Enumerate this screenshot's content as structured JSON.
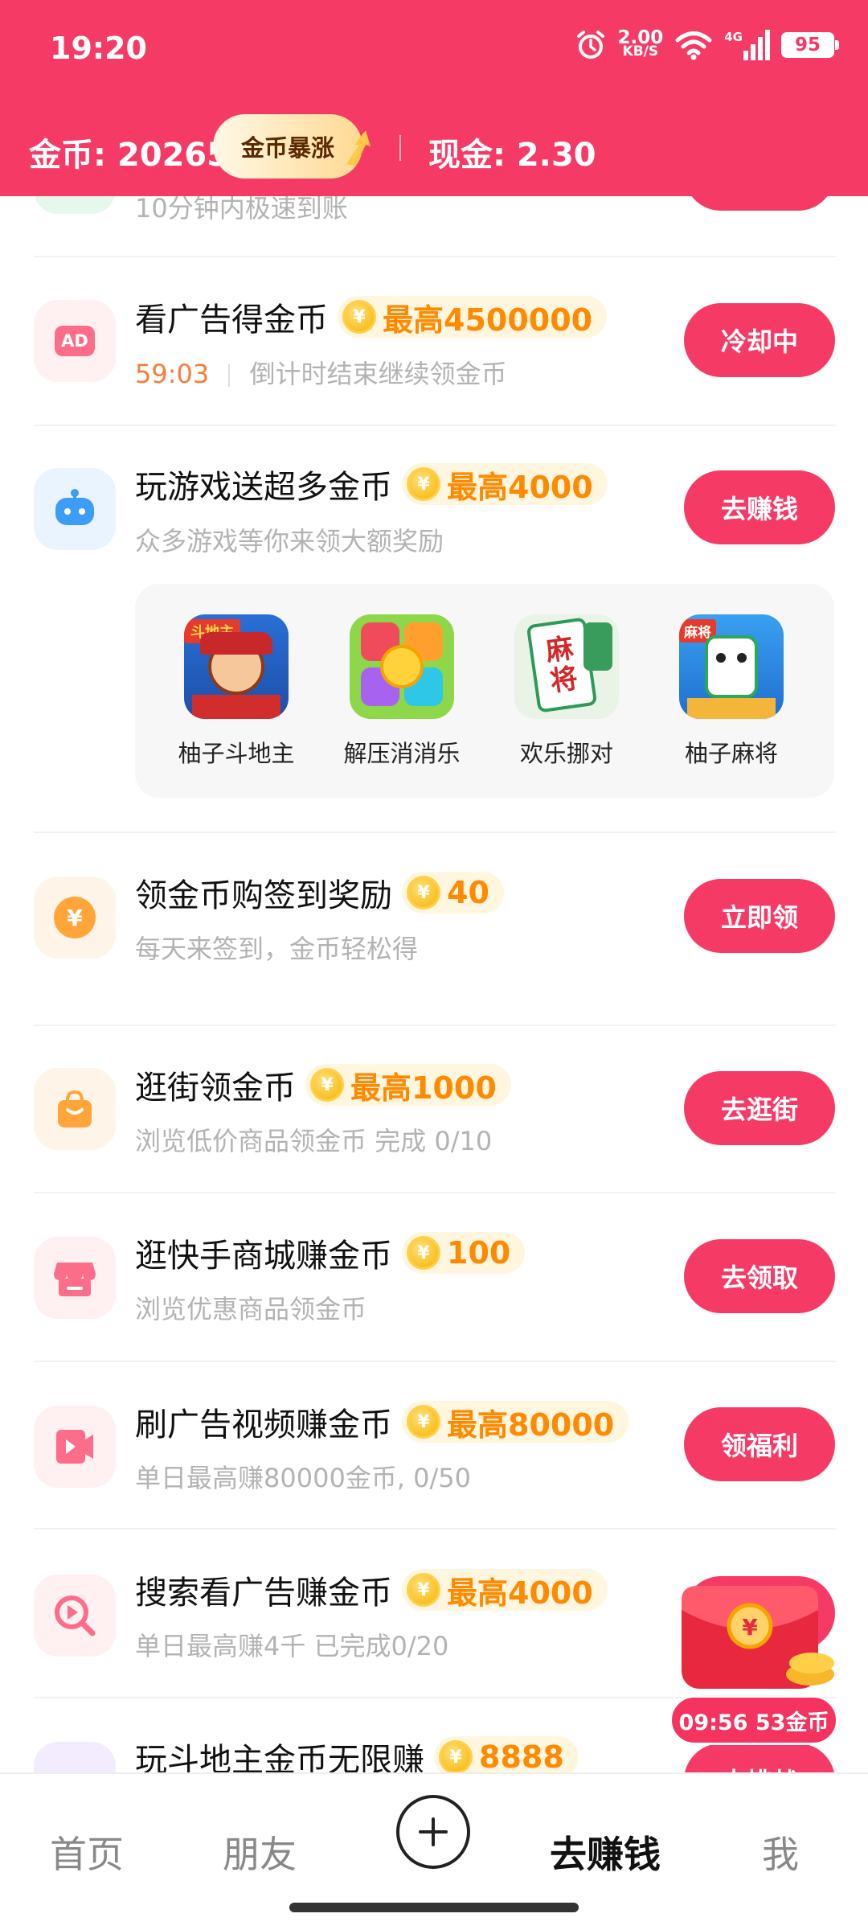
{
  "status_bar": {
    "time": "19:20",
    "net_speed": "2.00",
    "net_unit": "KB/S",
    "network": "4G",
    "battery": "95"
  },
  "header": {
    "coins_label": "金币: 20265",
    "boom_label": "金币暴涨",
    "cash_label": "现金: 2.30"
  },
  "partial_row": {
    "subtitle": "10分钟内极速到账"
  },
  "tasks": [
    {
      "title": "看广告得金币",
      "reward": "最高4500000",
      "countdown": "59:03",
      "subtitle": "倒计时结束继续领金币",
      "button": "冷却中",
      "icon": "ad-icon"
    },
    {
      "title": "玩游戏送超多金币",
      "reward": "最高4000",
      "subtitle": "众多游戏等你来领大额奖励",
      "button": "去赚钱",
      "icon": "game-controller-icon"
    },
    {
      "title": "领金币购签到奖励",
      "reward": "40",
      "subtitle": "每天来签到，金币轻松得",
      "button": "立即领",
      "icon": "yuan-icon"
    },
    {
      "title": "逛街领金币",
      "reward": "最高1000",
      "subtitle": "浏览低价商品领金币 完成 0/10",
      "button": "去逛街",
      "icon": "shopping-bag-icon"
    },
    {
      "title": "逛快手商城赚金币",
      "reward": "100",
      "subtitle": "浏览优惠商品领金币",
      "button": "去领取",
      "icon": "store-icon"
    },
    {
      "title": "刷广告视频赚金币",
      "reward": "最高80000",
      "subtitle": "单日最高赚80000金币, 0/50",
      "button": "领福利",
      "icon": "video-play-icon"
    },
    {
      "title": "搜索看广告赚金币",
      "reward": "最高4000",
      "subtitle": "单日最高赚4千 已完成0/20",
      "button": "",
      "icon": "search-play-icon"
    },
    {
      "title": "玩斗地主金币无限赚",
      "reward": "8888",
      "subtitle": "",
      "button": "去挑战",
      "icon": "cards-icon"
    }
  ],
  "games": [
    {
      "label": "柚子斗地主",
      "icon_text": "斗地主"
    },
    {
      "label": "解压消消乐",
      "icon_text": ""
    },
    {
      "label": "欢乐挪对",
      "icon_text": "麻将"
    },
    {
      "label": "柚子麻将",
      "icon_text": "麻将"
    }
  ],
  "coin_symbol": "¥",
  "floating": {
    "timer": "09:56 53金币"
  },
  "nav": {
    "home": "首页",
    "friends": "朋友",
    "earn": "去赚钱",
    "me": "我"
  },
  "colors": {
    "accent": "#f63a66",
    "reward": "#ff8a00"
  }
}
